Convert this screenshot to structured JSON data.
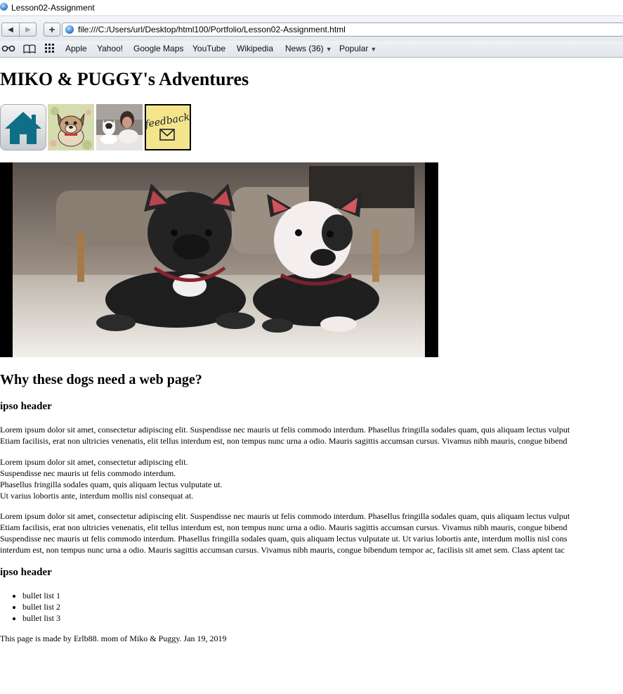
{
  "window": {
    "title": "Lesson02-Assignment"
  },
  "toolbar": {
    "url": "file:///C:/Users/url/Desktop/html100/Portfolio/Lesson02-Assignment.html"
  },
  "bookmarks": {
    "items": [
      {
        "label": "Apple"
      },
      {
        "label": "Yahoo!"
      },
      {
        "label": "Google Maps"
      },
      {
        "label": "YouTube"
      },
      {
        "label": "Wikipedia"
      },
      {
        "label": "News (36)",
        "has_dropdown": true
      },
      {
        "label": "Popular",
        "has_dropdown": true
      }
    ]
  },
  "page": {
    "title": "MIKO & PUGGY's Adventures",
    "thumbnails": [
      {
        "icon": "home-icon"
      },
      {
        "icon": "cartoon-dog-image"
      },
      {
        "icon": "person-with-dog-photo"
      },
      {
        "icon": "feedback-note-icon",
        "text": "feedback"
      }
    ],
    "section_heading": "Why these dogs need a web page?",
    "header1": "ipso header",
    "para1": [
      "Lorem ipsum dolor sit amet, consectetur adipiscing elit. Suspendisse nec mauris ut felis commodo interdum. Phasellus fringilla sodales quam, quis aliquam lectus vulput",
      "Etiam facilisis, erat non ultricies venenatis, elit tellus interdum est, non tempus nunc urna a odio. Mauris sagittis accumsan cursus. Vivamus nibh mauris, congue bibend"
    ],
    "para2": [
      "Lorem ipsum dolor sit amet, consectetur adipiscing elit.",
      "Suspendisse nec mauris ut felis commodo interdum.",
      "Phasellus fringilla sodales quam, quis aliquam lectus vulputate ut.",
      "Ut varius lobortis ante, interdum mollis nisl consequat at."
    ],
    "para3": [
      "Lorem ipsum dolor sit amet, consectetur adipiscing elit. Suspendisse nec mauris ut felis commodo interdum. Phasellus fringilla sodales quam, quis aliquam lectus vulput",
      "Etiam facilisis, erat non ultricies venenatis, elit tellus interdum est, non tempus nunc urna a odio. Mauris sagittis accumsan cursus. Vivamus nibh mauris, congue bibend",
      "Suspendisse nec mauris ut felis commodo interdum. Phasellus fringilla sodales quam, quis aliquam lectus vulputate ut. Ut varius lobortis ante, interdum mollis nisl cons",
      "interdum est, non tempus nunc urna a odio. Mauris sagittis accumsan cursus. Vivamus nibh mauris, congue bibendum tempor ac, facilisis sit amet sem. Class aptent tac"
    ],
    "header2": "ipso header",
    "bullets": [
      "bullet list 1",
      "bullet list 2",
      "bullet list 3"
    ],
    "footer": "This page is made by Erlb88. mom of Miko & Puggy. Jan 19, 2019"
  }
}
